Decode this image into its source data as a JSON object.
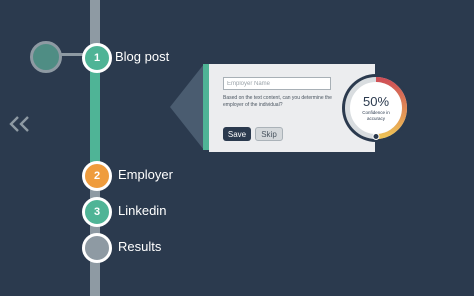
{
  "steps": [
    {
      "number": "1",
      "label": "Blog post",
      "status": "active"
    },
    {
      "number": "2",
      "label": "Employer",
      "status": "current"
    },
    {
      "number": "3",
      "label": "Linkedin",
      "status": "done"
    },
    {
      "number": "",
      "label": "Results",
      "status": "pending"
    }
  ],
  "form": {
    "employer_placeholder": "Employer Name",
    "employer_value": "",
    "question": "Based on the text content, can you determine the employer of the individual?",
    "save_label": "Save",
    "skip_label": "Skip"
  },
  "confidence": {
    "value_text": "50%",
    "value": 0.5,
    "label": "Confidence in accuracy"
  },
  "colors": {
    "background": "#2b3a4e",
    "active": "#4fb496",
    "current": "#ef9c3d",
    "pending": "#8e9aa3",
    "card": "#ecedef",
    "gauge_start": "#cf4f56",
    "gauge_end": "#efc255"
  },
  "icons": {
    "back": "double-chevron-left-icon",
    "avatar": "avatar-node"
  }
}
